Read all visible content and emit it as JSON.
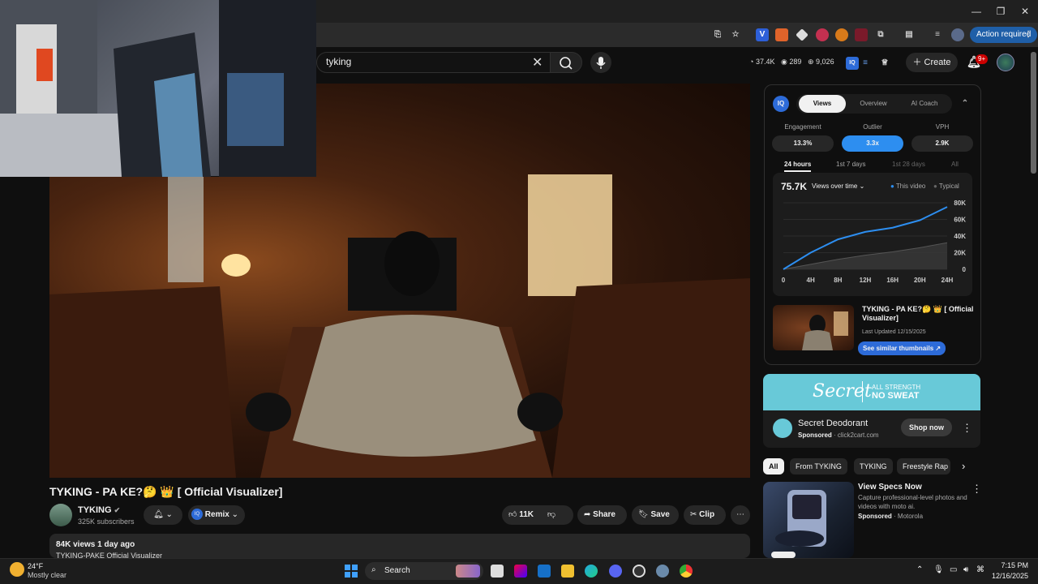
{
  "browser": {
    "action_required": "Action required",
    "window_controls": [
      "minimize-icon",
      "maximize-icon",
      "close-icon"
    ]
  },
  "header": {
    "search_value": "tyking",
    "stats": {
      "views": "37.4K",
      "likes": "289",
      "comments": "9,026"
    },
    "create_label": "Create",
    "notification_count": "9+"
  },
  "video": {
    "title": "TYKING - PA KE?🤔 👑 [ Official Visualizer]",
    "channel": "TYKING",
    "subscribers": "325K subscribers",
    "remix_label": "Remix",
    "likes": "11K",
    "share_label": "Share",
    "save_label": "Save",
    "clip_label": "Clip",
    "meta": "84K views  1 day ago",
    "description": "TYKING-PAKE Official Visualizer"
  },
  "iq": {
    "tabs": [
      "Views",
      "Overview",
      "AI Coach"
    ],
    "active_tab": "Views",
    "metrics": [
      {
        "label": "Engagement",
        "value": "13.3%"
      },
      {
        "label": "Outlier",
        "value": "3.3x"
      },
      {
        "label": "VPH",
        "value": "2.9K"
      }
    ],
    "time_tabs": [
      "24 hours",
      "1st 7 days",
      "1st 28 days",
      "All"
    ],
    "total_views": "75.7K",
    "dropdown_label": "Views over time",
    "legend_this": "This video",
    "legend_typical": "Typical",
    "thumb_title": "TYKING - PA KE?🤔 👑 [ Official Visualizer]",
    "last_updated": "Last Updated 12/15/2025",
    "similar_label": "See similar thumbnails"
  },
  "chart_data": {
    "type": "area",
    "x": [
      "0",
      "4H",
      "8H",
      "12H",
      "16H",
      "20H",
      "24H"
    ],
    "ylim": [
      0,
      80000
    ],
    "yticks": [
      "80K",
      "60K",
      "40K",
      "20K",
      "0"
    ],
    "series": [
      {
        "name": "This video",
        "values": [
          0,
          20000,
          36000,
          45000,
          50000,
          59000,
          75000
        ]
      },
      {
        "name": "Typical",
        "values": [
          0,
          6000,
          12000,
          17000,
          21000,
          26000,
          32000
        ]
      }
    ]
  },
  "ad": {
    "brand_logo": "Secret",
    "tagline1": "ALL STRENGTH",
    "tagline2": "NO SWEAT",
    "title": "Secret Deodorant",
    "sponsored": "Sponsored",
    "domain": "· click2cart.com",
    "shop_label": "Shop now"
  },
  "chips": [
    "All",
    "From TYKING",
    "TYKING",
    "Freestyle Rap"
  ],
  "suggested": {
    "title": "View Specs Now",
    "desc": "Capture professional-level photos and videos with moto ai.",
    "sponsored": "Sponsored",
    "advertiser": "· Motorola"
  },
  "taskbar": {
    "temp": "24°F",
    "weather": "Mostly clear",
    "search": "Search",
    "time": "7:15 PM",
    "date": "12/16/2025"
  }
}
